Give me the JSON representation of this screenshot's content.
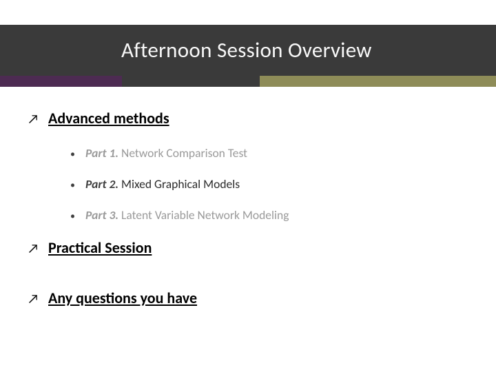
{
  "title": "Afternoon Session Overview",
  "sections": {
    "advanced": {
      "heading": "Advanced methods",
      "parts": [
        {
          "label": "Part 1.",
          "text": " Network Comparison Test"
        },
        {
          "label": "Part 2.",
          "text": " Mixed Graphical Models"
        },
        {
          "label": "Part 3.",
          "text": " Latent Variable Network Modeling"
        }
      ]
    },
    "practical": {
      "heading": "Practical Session"
    },
    "questions": {
      "heading": "Any questions you have"
    }
  },
  "glyphs": {
    "arrow": "↗",
    "bullet": "•"
  },
  "colors": {
    "header_bg": "#3a3a3a",
    "accent_purple": "#4d2b52",
    "accent_olive": "#8e8c58"
  }
}
